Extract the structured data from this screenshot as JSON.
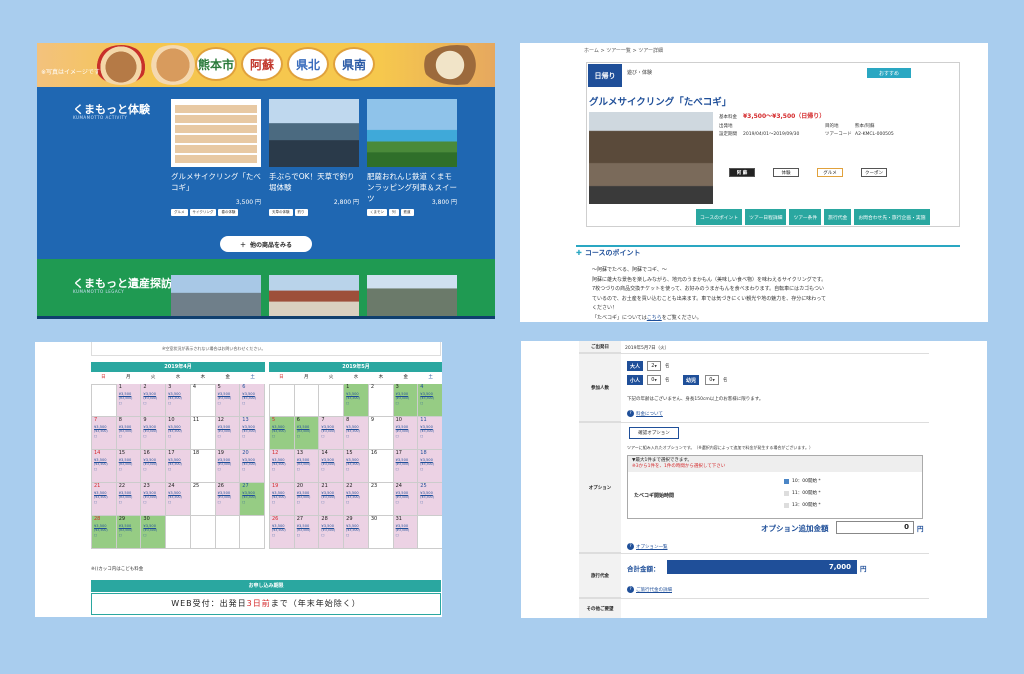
{
  "panel1": {
    "banner_note": "※写真はイメージです",
    "regions": [
      "熊本市",
      "阿蘇",
      "県北",
      "県南"
    ],
    "section1_title": "くまもっと体験",
    "section1_sub": "KUMAMOTTO ACTIVITY",
    "cards": [
      {
        "title": "グルメサイクリング「たべコギ」",
        "price": "3,500 円",
        "tags": [
          "グルメ",
          "サイクリング",
          "春の体験"
        ]
      },
      {
        "title": "手ぶらでOK！天草で釣り堀体験",
        "price": "2,800 円",
        "tags": [
          "天草の体験",
          "釣り"
        ]
      },
      {
        "title": "肥薩おれんじ鉄道 くまモンラッピング列車＆スイーツ",
        "price": "3,800 円",
        "tags": [
          "くまモン",
          "列",
          "鉄道"
        ]
      }
    ],
    "more_button": "他の商品をみる",
    "section2_title": "くまもっと遺産探訪",
    "section2_sub": "KUMAMOTTO LEGACY"
  },
  "panel2": {
    "breadcrumb": "ホーム > ツアー一覧 > ツアー詳細",
    "day_badge": "日帰り",
    "category": "遊び・体験",
    "recommend": "おすすめ",
    "tour_title": "グルメサイクリング「たべコギ」",
    "info": [
      {
        "label": "基本料金",
        "value": "¥3,500～¥3,500（日帰り）"
      },
      {
        "label": "出発地",
        "value": ""
      },
      {
        "label": "設定期間",
        "value": "2019/04/01～2019/09/30"
      }
    ],
    "info_right": [
      {
        "label": "",
        "value": ""
      },
      {
        "label": "目的地",
        "value": "熊本/阿蘇"
      },
      {
        "label": "ツアーコード",
        "value": "A2-KMCL-000505"
      }
    ],
    "tags": [
      "阿 蘇",
      "体験",
      "グルメ",
      "クーポン"
    ],
    "tabs": [
      "コースのポイント",
      "ツアー日程詳細",
      "ツアー条件",
      "旅行代金",
      "お問合わせ先・旅行企画・実施"
    ],
    "section_title": "コースのポイント",
    "body": [
      "～阿蘇でたべる、阿蘇でコギ、～",
      "阿蘇に雄大な景色を楽しみながら、地元のうまかもん（美味しい食べ物）を味わえるサイクリングです。",
      "7枚つづりの商品交換チケットを使って、お好みのうまかもんを食べまわります。自転車にはカゴもつい",
      "ているので、お土産を買い込むことも出来ます。車では気づきにくい観光や地の魅力を、存分に味わって",
      "ください！"
    ],
    "body_link_prefix": "「たべコギ」については",
    "body_link": "こちら",
    "body_link_suffix": "をご覧ください。"
  },
  "panel3": {
    "top_note": "※空室状況が表示されない場合はお問い合わせください。",
    "weekdays": [
      "日",
      "月",
      "火",
      "水",
      "木",
      "金",
      "土"
    ],
    "calendars": [
      {
        "title": "2019年4月",
        "days": [
          {
            "d": "",
            "c": ""
          },
          {
            "d": "1",
            "c": "pink"
          },
          {
            "d": "2",
            "c": "pink"
          },
          {
            "d": "3",
            "c": "pink"
          },
          {
            "d": "4",
            "c": ""
          },
          {
            "d": "5",
            "c": "pink"
          },
          {
            "d": "6",
            "c": "pink"
          },
          {
            "d": "7",
            "c": "pink"
          },
          {
            "d": "8",
            "c": "pink"
          },
          {
            "d": "9",
            "c": "pink"
          },
          {
            "d": "10",
            "c": "pink"
          },
          {
            "d": "11",
            "c": ""
          },
          {
            "d": "12",
            "c": "pink"
          },
          {
            "d": "13",
            "c": "pink"
          },
          {
            "d": "14",
            "c": "pink"
          },
          {
            "d": "15",
            "c": "pink"
          },
          {
            "d": "16",
            "c": "pink"
          },
          {
            "d": "17",
            "c": "pink"
          },
          {
            "d": "18",
            "c": ""
          },
          {
            "d": "19",
            "c": "pink"
          },
          {
            "d": "20",
            "c": "pink"
          },
          {
            "d": "21",
            "c": "pink"
          },
          {
            "d": "22",
            "c": "pink"
          },
          {
            "d": "23",
            "c": "pink"
          },
          {
            "d": "24",
            "c": "pink"
          },
          {
            "d": "25",
            "c": ""
          },
          {
            "d": "26",
            "c": "pink"
          },
          {
            "d": "27",
            "c": "green"
          },
          {
            "d": "28",
            "c": "green"
          },
          {
            "d": "29",
            "c": "green"
          },
          {
            "d": "30",
            "c": "green"
          },
          {
            "d": "",
            "c": ""
          },
          {
            "d": "",
            "c": ""
          },
          {
            "d": "",
            "c": ""
          },
          {
            "d": "",
            "c": ""
          }
        ]
      },
      {
        "title": "2019年5月",
        "days": [
          {
            "d": "",
            "c": ""
          },
          {
            "d": "",
            "c": ""
          },
          {
            "d": "",
            "c": ""
          },
          {
            "d": "1",
            "c": "green"
          },
          {
            "d": "2",
            "c": ""
          },
          {
            "d": "3",
            "c": "green"
          },
          {
            "d": "4",
            "c": "green"
          },
          {
            "d": "5",
            "c": "green"
          },
          {
            "d": "6",
            "c": "green"
          },
          {
            "d": "7",
            "c": "pink"
          },
          {
            "d": "8",
            "c": "pink"
          },
          {
            "d": "9",
            "c": ""
          },
          {
            "d": "10",
            "c": "pink"
          },
          {
            "d": "11",
            "c": "pink"
          },
          {
            "d": "12",
            "c": "pink"
          },
          {
            "d": "13",
            "c": "pink"
          },
          {
            "d": "14",
            "c": "pink"
          },
          {
            "d": "15",
            "c": "pink"
          },
          {
            "d": "16",
            "c": ""
          },
          {
            "d": "17",
            "c": "pink"
          },
          {
            "d": "18",
            "c": "pink"
          },
          {
            "d": "19",
            "c": "pink"
          },
          {
            "d": "20",
            "c": "pink"
          },
          {
            "d": "21",
            "c": "pink"
          },
          {
            "d": "22",
            "c": "pink"
          },
          {
            "d": "23",
            "c": ""
          },
          {
            "d": "24",
            "c": "pink"
          },
          {
            "d": "25",
            "c": "pink"
          },
          {
            "d": "26",
            "c": "pink"
          },
          {
            "d": "27",
            "c": "pink"
          },
          {
            "d": "28",
            "c": "pink"
          },
          {
            "d": "29",
            "c": "pink"
          },
          {
            "d": "30",
            "c": ""
          },
          {
            "d": "31",
            "c": "pink"
          },
          {
            "d": "",
            "c": ""
          }
        ]
      }
    ],
    "cell_price": "¥3,500",
    "cell_price_child": "(¥3,500)",
    "cell_mark": "□",
    "note": "※()カッコ内はこども料金",
    "deadline_header": "お申し込み期限",
    "deadline_prefix": "WEB受付：出発日",
    "deadline_red": "3日前",
    "deadline_suffix": "まで（年末年始除く）"
  },
  "panel4": {
    "row_date": "ご出発日",
    "date_value": "2019年5月7日（火）",
    "row_people": "参加人数",
    "adult_label": "大人",
    "adult_count": "2",
    "child_label": "小人",
    "child_count": "0",
    "infant_label": "幼児",
    "infant_count": "0",
    "unit": "名",
    "people_note": "下記の年齢はございません、身長150cm以上のお客様に限ります。",
    "help1": "料金について",
    "option_button": "確認オプション",
    "option_note": "ツアーに組み入れたオプションです。（※選択内容によって追加で料金が発生する場合がございます。）",
    "row_option": "オプション",
    "option_head1": "▼最大1件まで選択できます。",
    "option_head2": "※3から1件を、1件の時間から選択して下さい",
    "option_name": "たべコギ開始時間",
    "choices": [
      "10：00開始 *",
      "11：00開始 *",
      "13：00開始 *"
    ],
    "option_total_label": "オプション追加金額",
    "option_total": "0",
    "yen": "円",
    "help2": "オプション一覧",
    "row_price": "旅行代金",
    "total_label": "合計金額：",
    "total": "7,000",
    "help3": "ご旅行代金の詳細",
    "row_other": "その他ご要望"
  }
}
